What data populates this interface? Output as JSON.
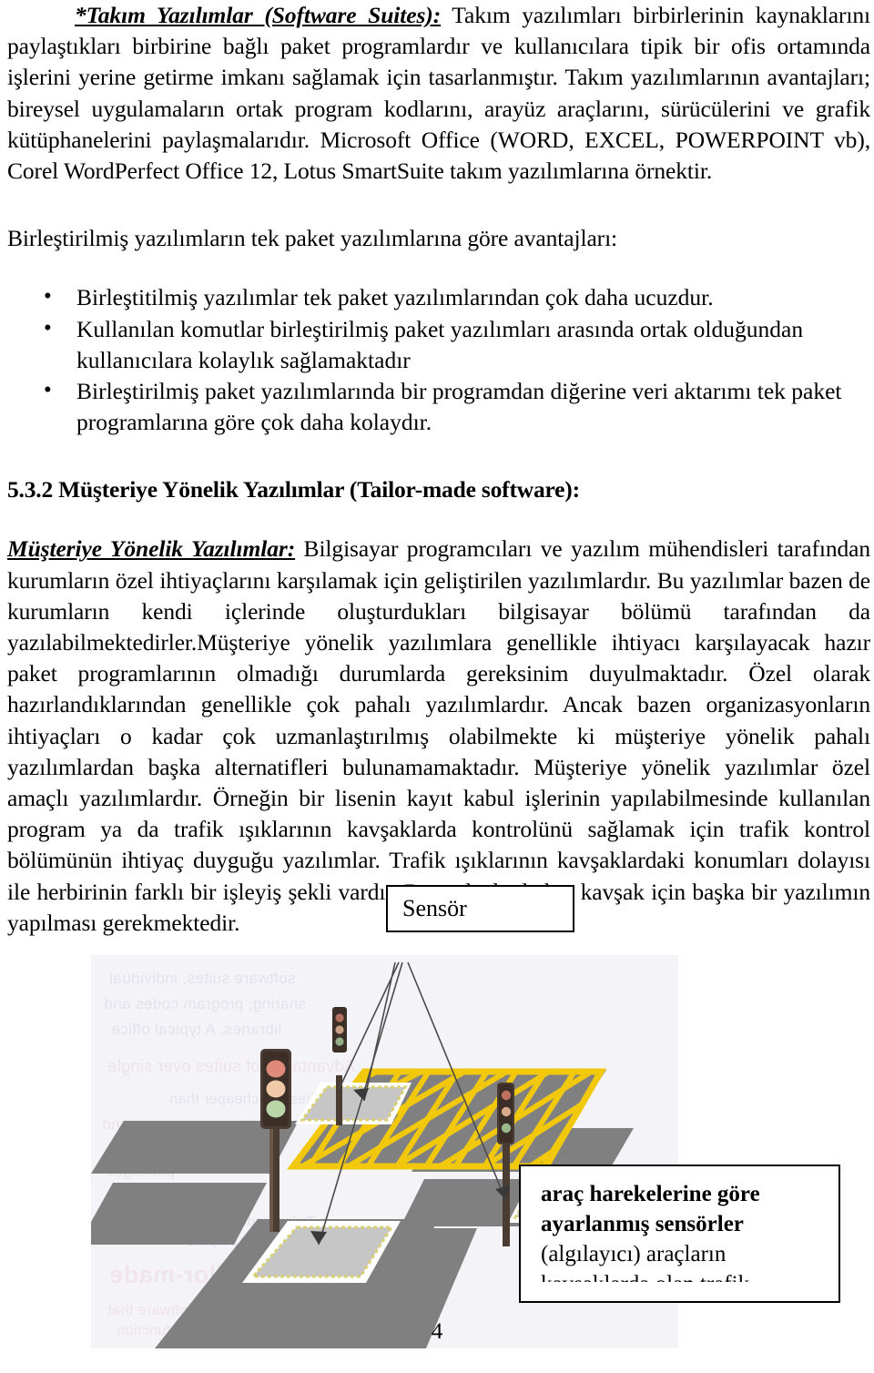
{
  "document": {
    "page_number": "4"
  },
  "section_suites": {
    "lead": "*Takım Yazılımlar (Software Suites):",
    "body": " Takım yazılımları birbirlerinin kaynaklarını paylaştıkları birbirine bağlı paket programlardır ve kullanıcılara tipik bir ofis ortamında işlerini yerine getirme imkanı sağlamak için tasarlanmıştır. Takım yazılımlarının avantajları; bireysel uygulamaların ortak program kodlarını, arayüz araçlarını, sürücülerini ve grafik kütüphanelerini paylaşmalarıdır. Microsoft Office (WORD, EXCEL, POWERPOINT vb), Corel WordPerfect Office 12, Lotus SmartSuite takım yazılımlarına örnektir."
  },
  "advantages": {
    "intro": "Birleştirilmiş yazılımların tek paket yazılımlarına göre avantajları:",
    "items": [
      "Birleştitilmiş yazılımlar tek paket yazılımlarından çok daha ucuzdur.",
      "Kullanılan komutlar birleştirilmiş paket yazılımları arasında ortak olduğundan kullanıcılara kolaylık sağlamaktadır",
      "Birleştirilmiş paket yazılımlarında bir programdan diğerine veri aktarımı tek paket programlarına göre çok daha kolaydır."
    ]
  },
  "section_tailor_made": {
    "heading": "5.3.2 Müşteriye Yönelik Yazılımlar (Tailor-made software):",
    "lead": "Müşteriye Yönelik Yazılımlar:",
    "body": " Bilgisayar programcıları ve yazılım mühendisleri tarafından kurumların özel ihtiyaçlarını karşılamak için  geliştirilen yazılımlardır. Bu yazılımlar bazen de kurumların kendi içlerinde oluşturdukları bilgisayar bölümü tarafından da yazılabilmektedirler.Müşteriye yönelik yazılımlara genellikle ihtiyacı karşılayacak hazır paket programlarının olmadığı durumlarda gereksinim duyulmaktadır. Özel olarak hazırlandıklarından genellikle çok pahalı yazılımlardır. Ancak bazen organizasyonların ihtiyaçları o kadar çok uzmanlaştırılmış olabilmekte ki müşteriye yönelik pahalı yazılımlardan başka alternatifleri bulunamamaktadır. Müşteriye yönelik yazılımlar özel amaçlı yazılımlardır. Örneğin bir lisenin kayıt kabul işlerinin yapılabilmesinde kullanılan program ya da trafik ışıklarının kavşaklarda kontrolünü sağlamak için trafik kontrol bölümünün ihtiyaç duyguğu yazılımlar. Trafik ışıklarının kavşaklardaki konumları dolayısı ile herbirinin farklı bir işleyiş şekli vardır. Bu nedenle de her kavşak için başka bir yazılımın yapılması gerekmektedir."
  },
  "figure": {
    "sensor_label": "Sensör",
    "caption_lines": [
      "araç harekelerine göre",
      "ayarlanmış sensörler",
      "(algılayıcı) araçların",
      "kavşaklarda olan trafik"
    ],
    "caption_bold_count": 2,
    "colors": {
      "road": "#808080",
      "box_junction_yellow": "#f2c80c",
      "detector_zone": "#c6c6c6",
      "detector_border": "#d9cf73",
      "signal_housing": "#4a3b33",
      "lamp_red": "#e08a7a",
      "lamp_amber": "#f0c9a8",
      "lamp_green": "#b8d6a8",
      "scan_background": "#f4f4f8"
    },
    "ghost_text": [
      "software",
      "devices and",
      "individual",
      "Advantages of suites over single packages:",
      "suites are",
      "than single",
      "are common",
      "easier to",
      "Tailor-made",
      "the general"
    ]
  }
}
